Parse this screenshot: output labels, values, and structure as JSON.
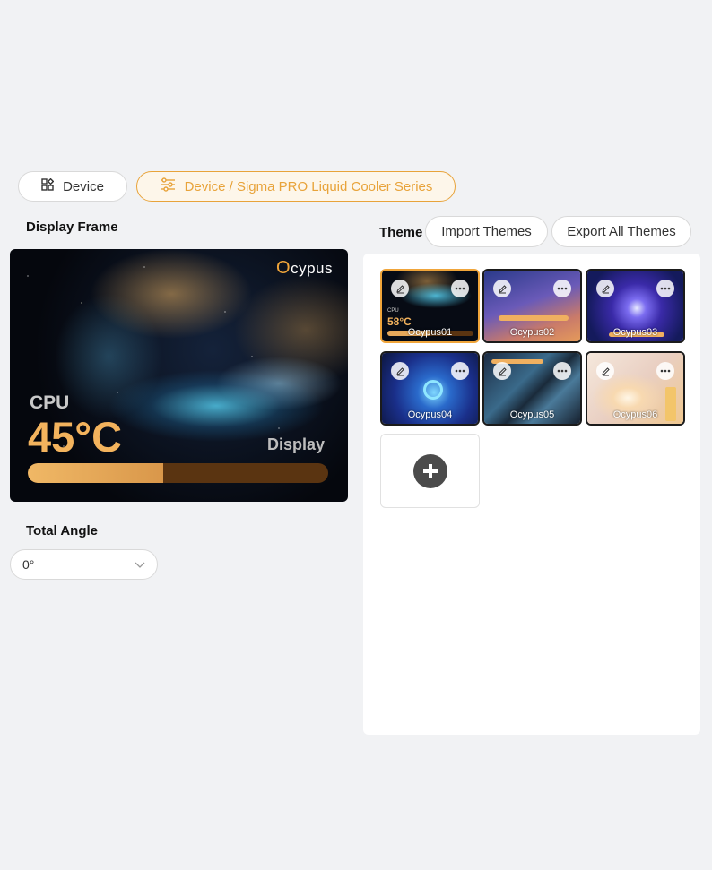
{
  "nav": {
    "device_label": "Device",
    "path_label": "Device / Sigma PRO Liquid Cooler Series"
  },
  "display_frame": {
    "heading": "Display Frame",
    "brand": "cypus",
    "brand_o": "O",
    "cpu_label": "CPU",
    "cpu_temp": "45°C",
    "display_label": "Display",
    "progress": 0.45
  },
  "angle": {
    "heading": "Total Angle",
    "value": "0°"
  },
  "theme": {
    "heading": "Theme",
    "import_label": "Import Themes",
    "export_label": "Export All Themes",
    "items": [
      {
        "name": "Ocypus01"
      },
      {
        "name": "Ocypus02"
      },
      {
        "name": "Ocypus03"
      },
      {
        "name": "Ocypus04"
      },
      {
        "name": "Ocypus05"
      },
      {
        "name": "Ocypus06"
      }
    ],
    "selected_index": 0
  },
  "colors": {
    "accent": "#e8a33a",
    "page_bg": "#f1f2f4"
  }
}
